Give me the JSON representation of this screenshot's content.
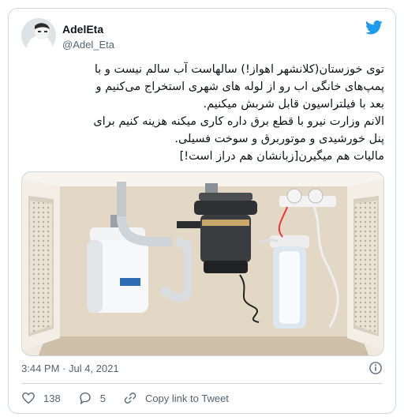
{
  "author": {
    "name": "AdelEta",
    "handle": "@Adel_Eta"
  },
  "tweet": {
    "lines": [
      "توی خوزستان(کلانشهر اهواز!) سالهاست آب سالم نیست و با",
      "پمپ‌های خانگی اب رو از لوله های شهری استخراج می‌کنیم و",
      "بعد با فیلتراسیون قابل شربش میکنیم.",
      "الانم وزارت نیرو با قطع برق داره کاری میکنه هزینه کنیم برای",
      "پنل خورشیدی و موتوربرق و سوخت فسیلی.",
      "مالیات هم میگیرن[زبانشان هم دراز است!]"
    ],
    "timestamp": "3:44 PM · Jul 4, 2021"
  },
  "actions": {
    "likes": "138",
    "replies": "5",
    "copy_link_label": "Copy link to Tweet"
  },
  "icons": {
    "brand": "twitter-bird-icon",
    "info": "info-icon",
    "like": "heart-icon",
    "reply": "reply-icon",
    "copy": "link-icon"
  },
  "colors": {
    "twitter_blue": "#1d9bf0",
    "muted": "#536471",
    "border": "#cfd9de"
  }
}
